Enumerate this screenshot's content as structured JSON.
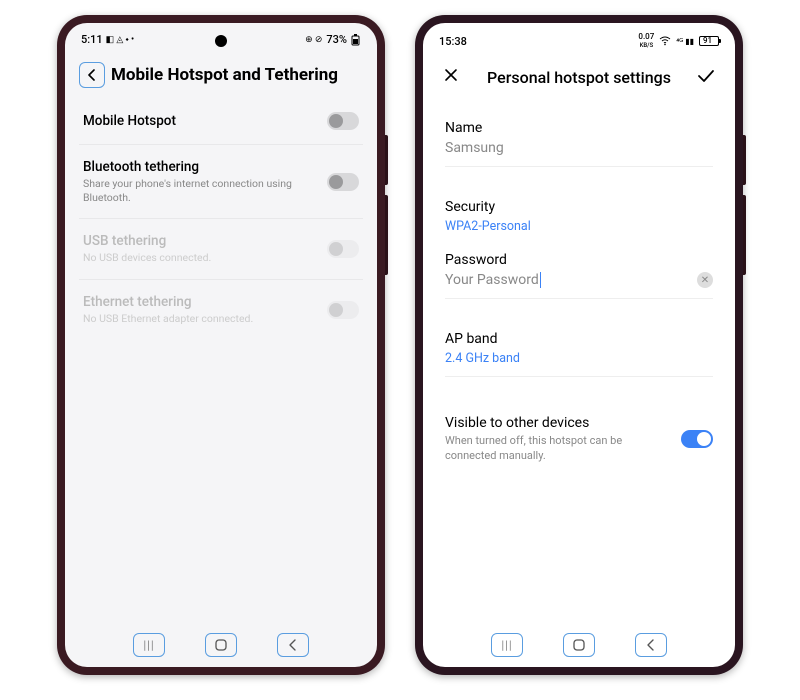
{
  "left": {
    "status": {
      "time": "5:11",
      "icons": "◧ ◬ ⬩ •",
      "right_text": "73%",
      "right_icons": "⊕ ⊘"
    },
    "header": {
      "title": "Mobile Hotspot and Tethering"
    },
    "rows": [
      {
        "title": "Mobile Hotspot",
        "sub": "",
        "enabled": true
      },
      {
        "title": "Bluetooth tethering",
        "sub": "Share your phone's internet connection using Bluetooth.",
        "enabled": true
      },
      {
        "title": "USB tethering",
        "sub": "No USB devices connected.",
        "enabled": false
      },
      {
        "title": "Ethernet tethering",
        "sub": "No USB Ethernet adapter connected.",
        "enabled": false
      }
    ]
  },
  "right": {
    "status": {
      "time": "15:38",
      "kbs": "0.07",
      "kbs_label": "KB/S",
      "battery": "91"
    },
    "header": {
      "title": "Personal hotspot settings"
    },
    "name": {
      "label": "Name",
      "value": "Samsung"
    },
    "security": {
      "label": "Security",
      "value": "WPA2-Personal"
    },
    "password": {
      "label": "Password",
      "value": "Your Password"
    },
    "apband": {
      "label": "AP band",
      "value": "2.4 GHz band"
    },
    "visible": {
      "title": "Visible to other devices",
      "sub": "When turned off, this hotspot can be connected manually."
    }
  },
  "nav": {
    "recents": "|||",
    "home": "◯",
    "back": "<"
  }
}
